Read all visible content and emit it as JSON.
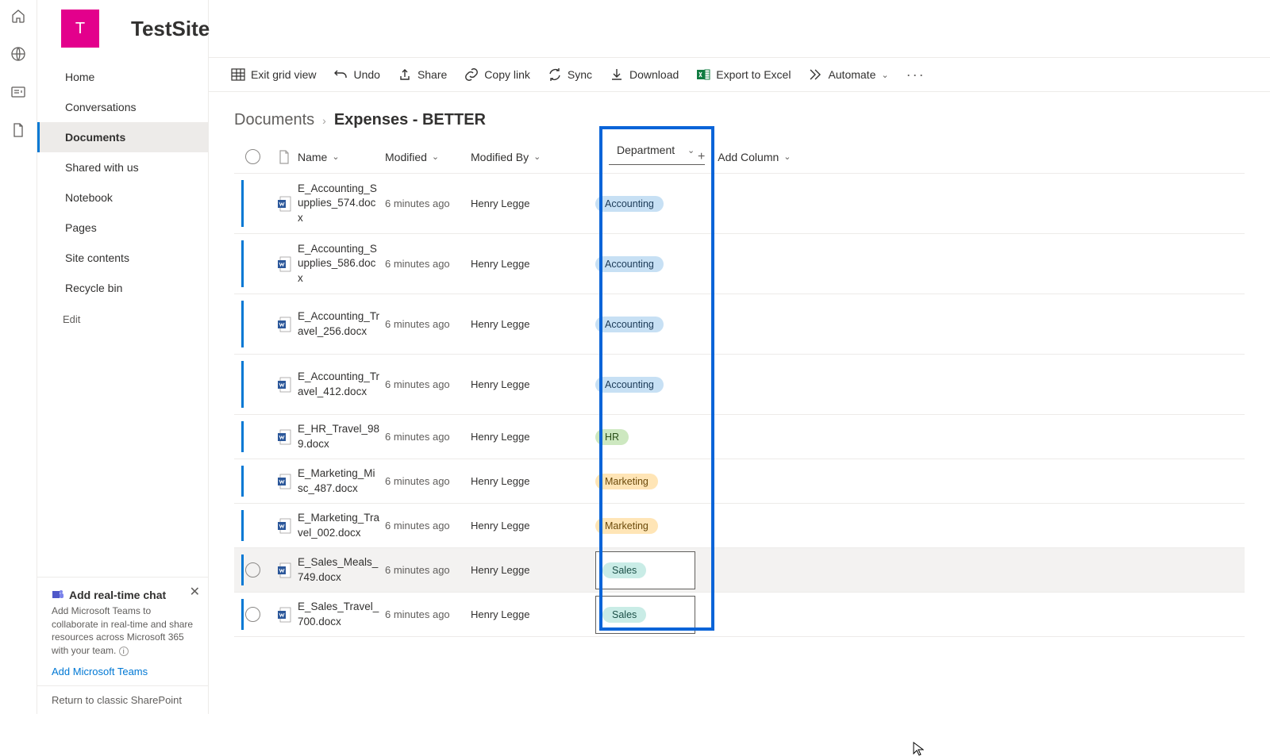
{
  "site": {
    "logo_letter": "T",
    "title": "TestSite"
  },
  "nav": {
    "items": [
      {
        "label": "Home"
      },
      {
        "label": "Conversations"
      },
      {
        "label": "Documents"
      },
      {
        "label": "Shared with us"
      },
      {
        "label": "Notebook"
      },
      {
        "label": "Pages"
      },
      {
        "label": "Site contents"
      },
      {
        "label": "Recycle bin"
      }
    ],
    "active_index": 2,
    "edit_label": "Edit"
  },
  "chat_panel": {
    "title": "Add real-time chat",
    "desc": "Add Microsoft Teams to collaborate in real-time and share resources across Microsoft 365 with your team.",
    "link": "Add Microsoft Teams"
  },
  "classic_link": "Return to classic SharePoint",
  "toolbar": {
    "exit_grid": "Exit grid view",
    "undo": "Undo",
    "share": "Share",
    "copy_link": "Copy link",
    "sync": "Sync",
    "download": "Download",
    "export_excel": "Export to Excel",
    "automate": "Automate"
  },
  "breadcrumb": {
    "root": "Documents",
    "current": "Expenses - BETTER"
  },
  "columns": {
    "name": "Name",
    "modified": "Modified",
    "modified_by": "Modified By",
    "department": "Department",
    "add": "Add Column"
  },
  "rows": [
    {
      "name": "E_Accounting_Supplies_574.docx",
      "modified": "6 minutes ago",
      "by": "Henry Legge",
      "dept": "Accounting",
      "h": "taller"
    },
    {
      "name": "E_Accounting_Supplies_586.docx",
      "modified": "6 minutes ago",
      "by": "Henry Legge",
      "dept": "Accounting",
      "h": "taller"
    },
    {
      "name": "E_Accounting_Travel_256.docx",
      "modified": "6 minutes ago",
      "by": "Henry Legge",
      "dept": "Accounting",
      "h": "taller"
    },
    {
      "name": "E_Accounting_Travel_412.docx",
      "modified": "6 minutes ago",
      "by": "Henry Legge",
      "dept": "Accounting",
      "h": "taller"
    },
    {
      "name": "E_HR_Travel_989.docx",
      "modified": "6 minutes ago",
      "by": "Henry Legge",
      "dept": "HR",
      "h": ""
    },
    {
      "name": "E_Marketing_Misc_487.docx",
      "modified": "6 minutes ago",
      "by": "Henry Legge",
      "dept": "Marketing",
      "h": ""
    },
    {
      "name": "E_Marketing_Travel_002.docx",
      "modified": "6 minutes ago",
      "by": "Henry Legge",
      "dept": "Marketing",
      "h": ""
    },
    {
      "name": "E_Sales_Meals_749.docx",
      "modified": "6 minutes ago",
      "by": "Henry Legge",
      "dept": "Sales",
      "h": "",
      "hovered": true,
      "editing": true
    },
    {
      "name": "E_Sales_Travel_700.docx",
      "modified": "6 minutes ago",
      "by": "Henry Legge",
      "dept": "Sales",
      "h": "",
      "editing": true
    }
  ]
}
